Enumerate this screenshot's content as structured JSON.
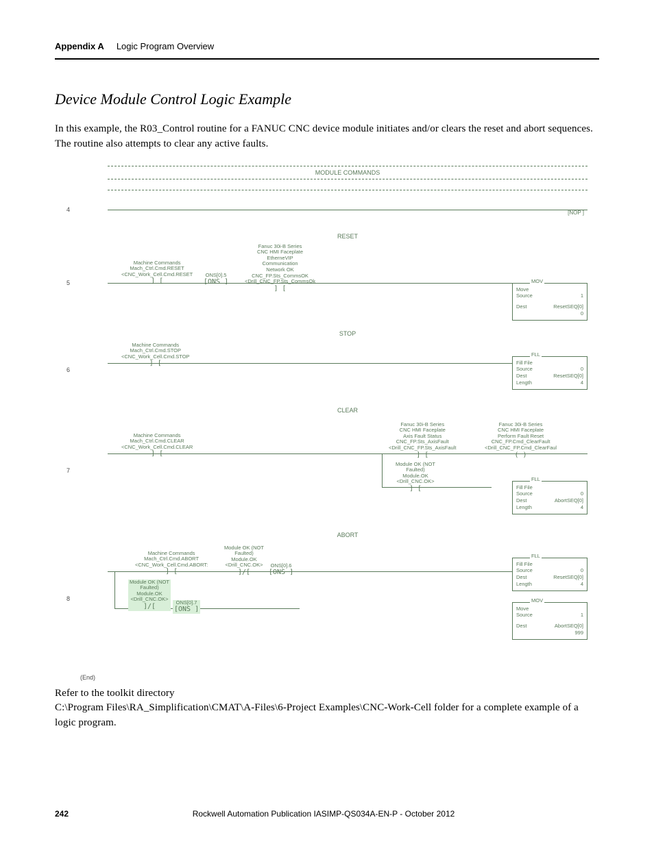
{
  "header": {
    "appendix": "Appendix A",
    "title": "Logic Program Overview"
  },
  "section_title": "Device Module Control Logic Example",
  "intro_text": "In this example, the R03_Control routine for a FANUC CNC device module initiates and/or clears the reset and abort sequences. The routine also attempts to clear any active faults.",
  "diagram": {
    "module_header": "MODULE COMMANDS",
    "rungs": [
      {
        "num": "4",
        "label": "",
        "nop": "[NOP ]"
      },
      {
        "num": "5",
        "label": "RESET"
      },
      {
        "num": "6",
        "label": "STOP"
      },
      {
        "num": "7",
        "label": "CLEAR"
      },
      {
        "num": "8",
        "label": "ABORT"
      }
    ],
    "end": "(End)",
    "r5": {
      "c1": {
        "l1": "Machine Commands",
        "l2": "Mach_Ctrl.Cmd.RESET",
        "l3": "<CNC_Work_Cell.Cmd.RESET"
      },
      "c2": {
        "l1": "ONS[0].5",
        "sym": "[ONS ]"
      },
      "c3": {
        "l1": "Fanuc 30i-B Series",
        "l2": "CNC HMI Faceplate",
        "l3": "EtherneVIP",
        "l4": "Communication",
        "l5": "Network OK",
        "l6": "CNC_FP.Sts_CommsOK",
        "l7": "<Drill_CNC_FP.Sts_CommsOk"
      },
      "box": {
        "title": "MOV",
        "r1a": "Move",
        "r1b": "",
        "r2a": "Source",
        "r2b": "1",
        "r3a": "Dest",
        "r3b": "ResetSEQ[0]",
        "r4b": "0"
      }
    },
    "r6": {
      "c1": {
        "l1": "Machine Commands",
        "l2": "Mach_Ctrl.Cmd.STOP",
        "l3": "<CNC_Work_Cell.Cmd.STOP"
      },
      "box": {
        "title": "FLL",
        "r1a": "Fill File",
        "r2a": "Source",
        "r2b": "0",
        "r3a": "Dest",
        "r3b": "ResetSEQ[0]",
        "r4a": "Length",
        "r4b": "4"
      }
    },
    "r7": {
      "c1": {
        "l1": "Machine Commands",
        "l2": "Mach_Ctrl.Cmd.CLEAR",
        "l3": "<CNC_Work_Cell.Cmd.CLEAR"
      },
      "c2": {
        "l1": "Fanuc 30i-B Series",
        "l2": "CNC HMI Faceplate",
        "l3": "Axis Fault Status",
        "l4": "CNC_FP.Sts_AxisFault",
        "l5": "<Drill_CNC_FP.Sts_AxisFault"
      },
      "c3": {
        "l1": "Fanuc 30i-B Series",
        "l2": "CNC HMI Faceplate",
        "l3": "Perform Fault Reset",
        "l4": "CNC_FP.Cmd_ClearFault",
        "l5": "<Drill_CNC_FP.Cmd_ClearFaul"
      },
      "c4": {
        "l1": "Module OK (NOT",
        "l2": "Faulted)",
        "l3": "Module.OK",
        "l4": "<Drill_CNC.OK>"
      },
      "box": {
        "title": "FLL",
        "r1a": "Fill File",
        "r2a": "Source",
        "r2b": "0",
        "r3a": "Dest",
        "r3b": "AbortSEQ[0]",
        "r4a": "Length",
        "r4b": "4"
      }
    },
    "r8": {
      "c1": {
        "l1": "Machine Commands",
        "l2": "Mach_Ctrl.Cmd.ABORT",
        "l3": "<CNC_Work_Cell.Cmd.ABORT:"
      },
      "c2": {
        "l1": "Module OK (NOT",
        "l2": "Faulted)",
        "l3": "Module.OK",
        "l4": "<Drill_CNC.OK>"
      },
      "c3": {
        "l1": "ONS[0].6",
        "sym": "[ONS ]"
      },
      "c4": {
        "l1": "Module OK (NOT",
        "l2": "Faulted)",
        "l3": "Module.OK",
        "l4": "<Drill_CNC.OK>"
      },
      "c5": {
        "l1": "ONS[0].7",
        "sym": "[ONS ]"
      },
      "box1": {
        "title": "FLL",
        "r1a": "Fill File",
        "r2a": "Source",
        "r2b": "0",
        "r3a": "Dest",
        "r3b": "ResetSEQ[0]",
        "r4a": "Length",
        "r4b": "4"
      },
      "box2": {
        "title": "MOV",
        "r1a": "Move",
        "r2a": "Source",
        "r2b": "1",
        "r3a": "Dest",
        "r3b": "AbortSEQ[0]",
        "r4b": "999"
      }
    }
  },
  "outro": {
    "l1": "Refer to the toolkit directory",
    "l2": "C:\\Program Files\\RA_Simplification\\CMAT\\A-Files\\6-Project Examples\\CNC-Work-Cell folder for a complete example of a logic program."
  },
  "footer": {
    "page": "242",
    "pub": "Rockwell Automation Publication IASIMP-QS034A-EN-P - ",
    "date": "October 2012"
  }
}
